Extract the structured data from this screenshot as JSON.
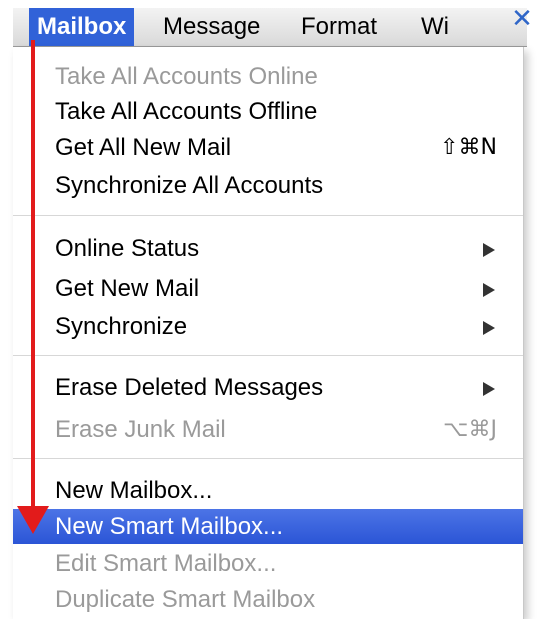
{
  "menubar": {
    "items": [
      {
        "label": "Mailbox"
      },
      {
        "label": "Message"
      },
      {
        "label": "Format"
      },
      {
        "label": "Wi"
      }
    ],
    "close_symbol": "✕"
  },
  "menu": {
    "items": [
      {
        "label": "Take All Accounts Online",
        "state": "disabled"
      },
      {
        "label": "Take All Accounts Offline",
        "state": "enabled"
      },
      {
        "label": "Get All New Mail",
        "shortcut": "⇧⌘N",
        "state": "enabled"
      },
      {
        "label": "Synchronize All Accounts",
        "state": "enabled"
      },
      {
        "label": "Online Status",
        "submenu": true,
        "state": "enabled"
      },
      {
        "label": "Get New Mail",
        "submenu": true,
        "state": "enabled"
      },
      {
        "label": "Synchronize",
        "submenu": true,
        "state": "enabled"
      },
      {
        "label": "Erase Deleted Messages",
        "submenu": true,
        "state": "enabled"
      },
      {
        "label": "Erase Junk Mail",
        "shortcut": "⌥⌘J",
        "state": "disabled"
      },
      {
        "label": "New Mailbox...",
        "state": "enabled"
      },
      {
        "label": "New Smart Mailbox...",
        "state": "highlighted"
      },
      {
        "label": "Edit Smart Mailbox...",
        "state": "disabled"
      },
      {
        "label": "Duplicate Smart Mailbox",
        "state": "disabled"
      }
    ]
  },
  "colors": {
    "highlight": "#3162d8",
    "annotation_arrow": "#e21b1b",
    "close_icon": "#2f66c8"
  }
}
